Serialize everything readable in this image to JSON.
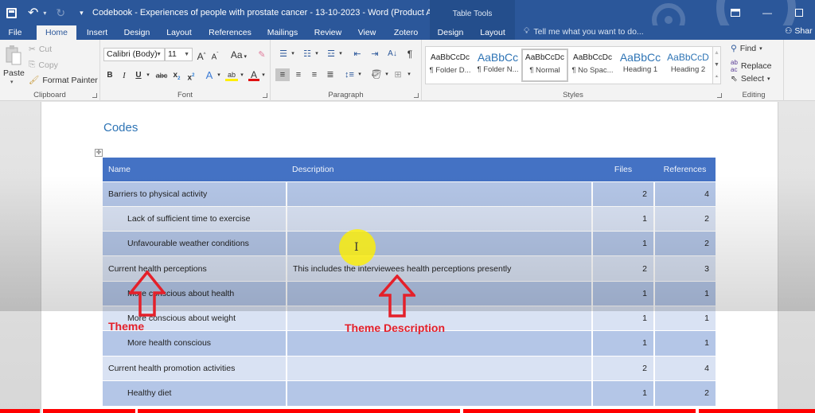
{
  "titlebar": {
    "title": "Codebook - Experiences of people with prostate cancer - 13-10-2023 - Word (Product Activat...",
    "contextual_group": "Table Tools",
    "window_controls": [
      "ribbon-display-options",
      "minimize",
      "maximize"
    ]
  },
  "tabs": [
    {
      "label": "File"
    },
    {
      "label": "Home",
      "active": true
    },
    {
      "label": "Insert"
    },
    {
      "label": "Design"
    },
    {
      "label": "Layout"
    },
    {
      "label": "References"
    },
    {
      "label": "Mailings"
    },
    {
      "label": "Review"
    },
    {
      "label": "View"
    },
    {
      "label": "Zotero"
    },
    {
      "label": "Design"
    },
    {
      "label": "Layout"
    }
  ],
  "tell_me": "Tell me what you want to do...",
  "share": "Shar",
  "ribbon": {
    "clipboard": {
      "label": "Clipboard",
      "paste": "Paste",
      "cut": "Cut",
      "copy": "Copy",
      "format_painter": "Format Painter"
    },
    "font": {
      "label": "Font",
      "font_name": "Calibri (Body)",
      "font_size": "11",
      "change_case": "Aa"
    },
    "paragraph": {
      "label": "Paragraph"
    },
    "styles": {
      "label": "Styles",
      "items": [
        {
          "preview": "AaBbCcDc",
          "name": "¶ Folder D..."
        },
        {
          "preview": "AaBbCc",
          "name": "¶ Folder N..."
        },
        {
          "preview": "AaBbCcDc",
          "name": "¶ Normal",
          "selected": true
        },
        {
          "preview": "AaBbCcDc",
          "name": "¶ No Spac..."
        },
        {
          "preview": "AaBbCc",
          "name": "Heading 1"
        },
        {
          "preview": "AaBbCcD",
          "name": "Heading 2"
        }
      ]
    },
    "editing": {
      "label": "Editing",
      "find": "Find",
      "replace": "Replace",
      "select": "Select"
    }
  },
  "document": {
    "heading": "Codes",
    "table": {
      "headers": [
        "Name",
        "Description",
        "Files",
        "References"
      ],
      "rows": [
        {
          "name": "Barriers to physical activity",
          "description": "",
          "files": "2",
          "references": "4",
          "level": 0
        },
        {
          "name": "Lack of sufficient time to exercise",
          "description": "",
          "files": "1",
          "references": "2",
          "level": 1
        },
        {
          "name": "Unfavourable weather conditions",
          "description": "",
          "files": "1",
          "references": "2",
          "level": 1
        },
        {
          "name": "Current health perceptions",
          "description": "This includes the interviewees health perceptions presently",
          "files": "2",
          "references": "3",
          "level": 0
        },
        {
          "name": "More conscious about health",
          "description": "",
          "files": "1",
          "references": "1",
          "level": 1
        },
        {
          "name": "More conscious about weight",
          "description": "",
          "files": "1",
          "references": "1",
          "level": 1
        },
        {
          "name": "More health conscious",
          "description": "",
          "files": "1",
          "references": "1",
          "level": 1
        },
        {
          "name": "Current health promotion activities",
          "description": "",
          "files": "2",
          "references": "4",
          "level": 0
        },
        {
          "name": "Healthy diet",
          "description": "",
          "files": "1",
          "references": "2",
          "level": 1
        }
      ]
    }
  },
  "annotations": {
    "theme": "Theme",
    "theme_description": "Theme Description",
    "color": "#e4202a"
  },
  "colors": {
    "title_bar": "#2b579a",
    "table_header": "#4472c4",
    "row_band_dark": "#b4c6e7",
    "row_band_light": "#d9e2f3",
    "heading": "#2e74b5",
    "cursor_highlight": "#fff000"
  }
}
